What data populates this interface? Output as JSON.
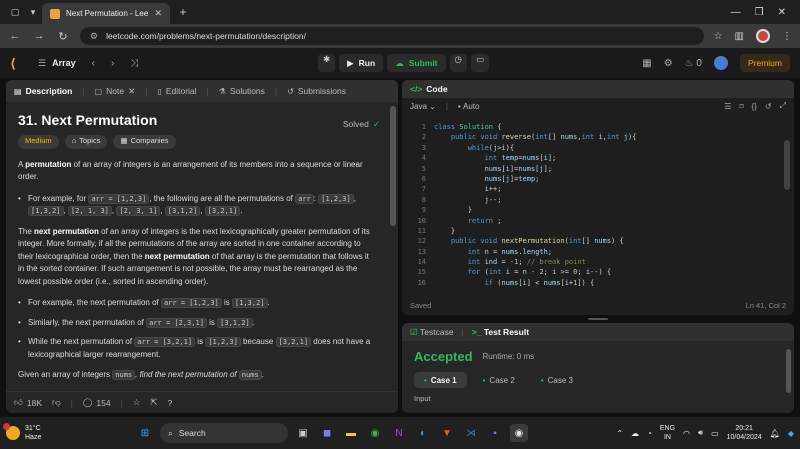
{
  "browser": {
    "tab_title": "Next Permutation - LeetCode",
    "url": "leetcode.com/problems/next-permutation/description/"
  },
  "nav": {
    "list_name": "Array",
    "run": "Run",
    "submit": "Submit",
    "fire_count": "0",
    "premium": "Premium"
  },
  "left_tabs": [
    "Description",
    "Note",
    "Editorial",
    "Solutions",
    "Submissions"
  ],
  "problem": {
    "title": "31. Next Permutation",
    "solved": "Solved",
    "chips": [
      "Medium",
      "Topics",
      "Companies"
    ],
    "p1_pre": "A ",
    "p1_bold": "permutation",
    "p1_post": " of an array of integers is an arrangement of its members into a sequence or linear order.",
    "b1_pre": "For example, for ",
    "b1_code1": "arr = [1,2,3]",
    "b1_mid": ", the following are all the permutations of ",
    "b1_code2": "arr",
    "b1_colon": ": ",
    "b1_perms": [
      "[1,2,3]",
      "[1,3,2]",
      "[2, 1, 3]",
      "[2, 3, 1]",
      "[3,1,2]",
      "[3,2,1]"
    ],
    "b1_end": ".",
    "p2_pre": "The ",
    "p2_b1": "next permutation",
    "p2_mid": " of an array of integers is the next lexicographically greater permutation of its integer. More formally, if all the permutations of the array are sorted in one container according to their lexicographical order, then the ",
    "p2_b2": "next permutation",
    "p2_post": " of that array is the permutation that follows it in the sorted container. If such arrangement is not possible, the array must be rearranged as the lowest possible order (i.e., sorted in ascending order).",
    "b2_pre": "For example, the next permutation of ",
    "b2_code1": "arr = [1,2,3]",
    "b2_mid": " is ",
    "b2_code2": "[1,3,2]",
    "b2_end": ".",
    "b3_pre": "Similarly, the next permutation of ",
    "b3_code1": "arr = [2,3,1]",
    "b3_mid": " is ",
    "b3_code2": "[3,1,2]",
    "b3_end": ".",
    "b4_pre": "While the next permutation of ",
    "b4_code1": "arr = [3,2,1]",
    "b4_mid": " is ",
    "b4_code2": "[1,2,3]",
    "b4_mid2": " because ",
    "b4_code3": "[3,2,1]",
    "b4_post": " does not have a lexicographical larger rearrangement.",
    "p3_pre": "Given an array of integers ",
    "p3_code1": "nums",
    "p3_it": ", find the next permutation of ",
    "p3_code2": "nums",
    "p3_end": "."
  },
  "footer": {
    "likes": "18K",
    "comments": "154"
  },
  "code": {
    "header": "Code",
    "lang": "Java",
    "auto": "Auto",
    "saved": "Saved",
    "position": "Ln 41, Col 2",
    "line_numbers": [
      "1",
      "2",
      "3",
      "4",
      "5",
      "6",
      "7",
      "8",
      "9",
      "10",
      "11",
      "12",
      "13",
      "14",
      "15",
      "16"
    ]
  },
  "test": {
    "tab_testcase": "Testcase",
    "tab_result": "Test Result",
    "status": "Accepted",
    "runtime": "Runtime: 0 ms",
    "cases": [
      "Case 1",
      "Case 2",
      "Case 3"
    ],
    "input_label": "Input"
  },
  "taskbar": {
    "temp": "31°C",
    "weather": "Haze",
    "search": "Search",
    "lang1": "ENG",
    "lang2": "IN",
    "time": "20:21",
    "date": "10/04/2024"
  }
}
